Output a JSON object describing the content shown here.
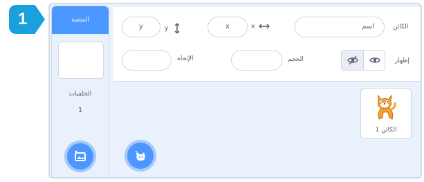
{
  "step_badge": "1",
  "stage": {
    "header": "المنصة",
    "backdrops_label": "الخلفيات",
    "backdrops_count": "1"
  },
  "sprite_info": {
    "sprite_label": "الكائن",
    "name_value": "اسم",
    "x_label": "x",
    "x_value": "x",
    "y_label": "y",
    "y_value": "y",
    "show_label": "إظهار",
    "size_label": "الحجم",
    "direction_label": "الإتجاه"
  },
  "sprites": [
    {
      "name": "الكائن 1",
      "icon": "cat-sprite-icon"
    }
  ],
  "buttons": {
    "choose_backdrop_icon": "backdrop-picture-icon",
    "choose_sprite_icon": "cat-face-icon"
  },
  "colors": {
    "accent": "#4c97ff",
    "badge": "#1aa0dc",
    "panel_bg": "#e9f1fc"
  }
}
